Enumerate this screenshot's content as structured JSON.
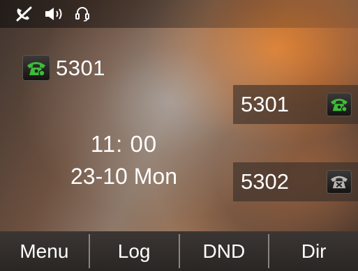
{
  "status_bar": {
    "icons": [
      "muted-phone-icon",
      "speaker-volume-icon",
      "headset-icon"
    ]
  },
  "account": {
    "label": "5301",
    "icon": "phone-registered-icon",
    "icon_color": "#3dbb3a"
  },
  "clock": {
    "time": "11:  00",
    "date": "23-10 Mon"
  },
  "line_keys": [
    {
      "label": "5301",
      "icon": "phone-registered-icon",
      "icon_color": "#3dbb3a"
    },
    {
      "label": "5302",
      "icon": "phone-unregistered-icon",
      "icon_color": "#b5b5b5"
    }
  ],
  "softkeys": {
    "menu": "Menu",
    "log": "Log",
    "dnd": "DND",
    "dir": "Dir"
  }
}
